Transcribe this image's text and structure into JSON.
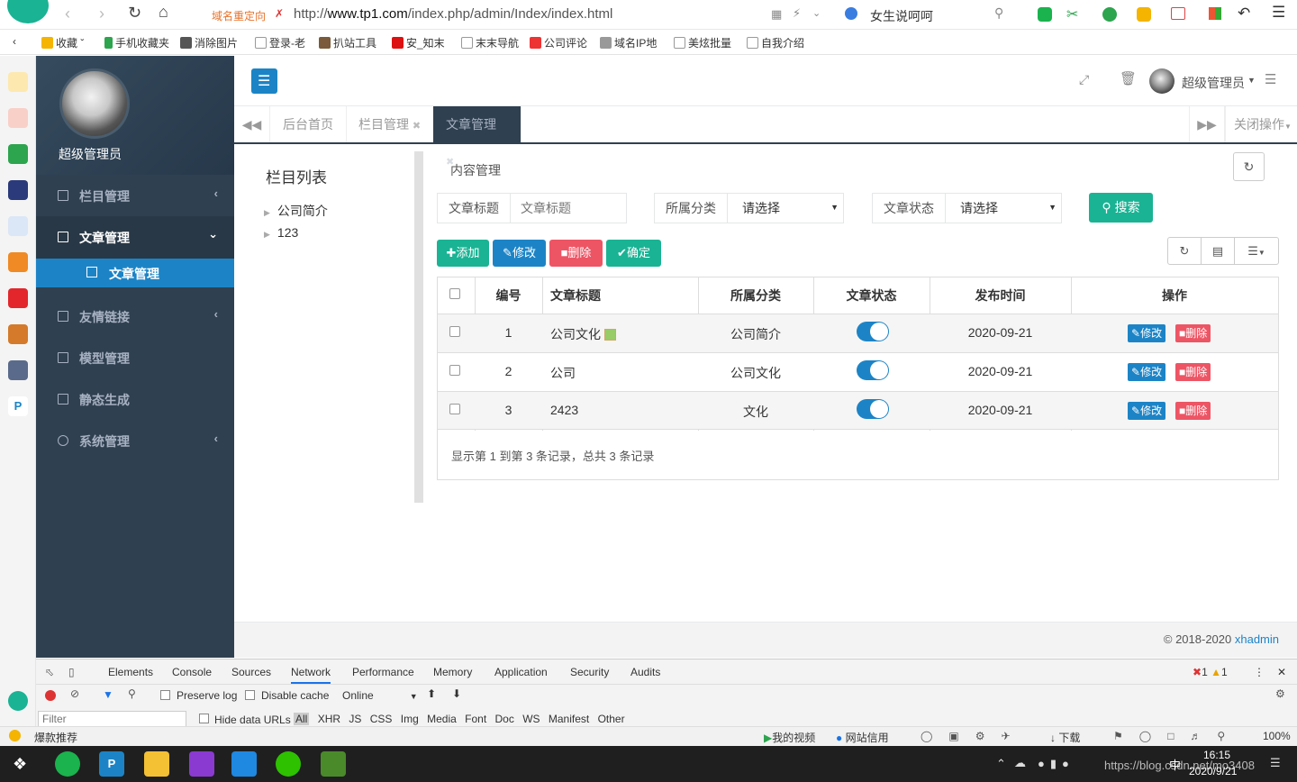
{
  "browser": {
    "redirect_label": "域名重定向",
    "url_prefix": "http://",
    "url_host": "www.tp1.com",
    "url_path": "/index.php/admin/Index/index.html",
    "search_hint": "女生说呵呵"
  },
  "bookmarks": [
    "收藏",
    "手机收藏夹",
    "消除图片",
    "登录-老",
    "扒站工具",
    "安_知末",
    "末末导航",
    "公司评论",
    "域名IP地",
    "美炫批量",
    "自我介绍"
  ],
  "sidebar": {
    "user_name": "超级管理员",
    "items": [
      {
        "label": "栏目管理"
      },
      {
        "label": "文章管理"
      },
      {
        "label": "友情链接"
      },
      {
        "label": "模型管理"
      },
      {
        "label": "静态生成"
      },
      {
        "label": "系统管理"
      }
    ],
    "sub_item": "文章管理"
  },
  "header": {
    "admin_name": "超级管理员"
  },
  "tabs": [
    {
      "label": "后台首页"
    },
    {
      "label": "栏目管理"
    },
    {
      "label": "文章管理"
    }
  ],
  "tabs_close_ops": "关闭操作",
  "tree": {
    "title": "栏目列表",
    "nodes": [
      "公司简介",
      "123"
    ]
  },
  "main": {
    "title": "内容管理",
    "filters": {
      "title_label": "文章标题",
      "title_placeholder": "文章标题",
      "category_label": "所属分类",
      "category_value": "请选择",
      "status_label": "文章状态",
      "status_value": "请选择",
      "search_button": "搜索"
    },
    "toolbar": {
      "add": "添加",
      "edit": "修改",
      "delete": "删除",
      "confirm": "确定"
    },
    "table": {
      "headers": [
        "编号",
        "文章标题",
        "所属分类",
        "文章状态",
        "发布时间",
        "操作"
      ],
      "rows": [
        {
          "id": "1",
          "title": "公司文化",
          "category": "公司简介",
          "status": true,
          "date": "2020-09-21"
        },
        {
          "id": "2",
          "title": "公司",
          "category": "公司文化",
          "status": true,
          "date": "2020-09-21"
        },
        {
          "id": "3",
          "title": "2423",
          "category": "文化",
          "status": true,
          "date": "2020-09-21"
        }
      ],
      "row_edit": "修改",
      "row_delete": "删除",
      "summary": "显示第 1 到第 3 条记录，总共 3 条记录"
    }
  },
  "footer": {
    "copyright": "© 2018-2020 ",
    "brand": "xhadmin"
  },
  "devtools": {
    "tabs": [
      "Elements",
      "Console",
      "Sources",
      "Network",
      "Performance",
      "Memory",
      "Application",
      "Security",
      "Audits"
    ],
    "active_tab": "Network",
    "error_count": "1",
    "warn_count": "1",
    "preserve_log": "Preserve log",
    "disable_cache": "Disable cache",
    "throttle": "Online",
    "filter_placeholder": "Filter",
    "hide_data_urls": "Hide data URLs",
    "types": [
      "All",
      "XHR",
      "JS",
      "CSS",
      "Img",
      "Media",
      "Font",
      "Doc",
      "WS",
      "Manifest",
      "Other"
    ]
  },
  "statusbar": {
    "left": "爆款推荐",
    "video": "我的视频",
    "credit": "网站信用",
    "download": "下载",
    "zoom": "100%"
  },
  "taskbar": {
    "time": "16:15",
    "date": "2020/9/21",
    "watermark": "https://blog.csdn.net/mo3408",
    "ime": "中"
  },
  "colors": {
    "sidebar": "#2f4050",
    "primary": "#1c84c6",
    "success": "#1ab394",
    "danger": "#ed5565"
  }
}
